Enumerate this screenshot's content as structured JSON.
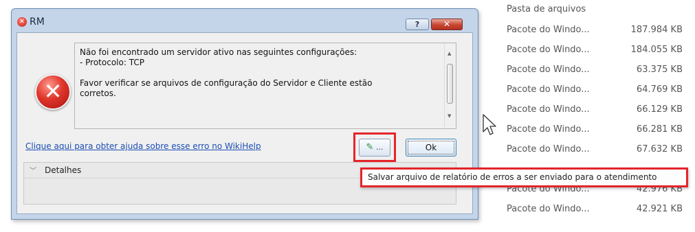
{
  "dialog": {
    "title": "RM",
    "title_icon": "error-icon",
    "help_label": "?",
    "close_label": "✕",
    "message_lines": [
      "Não foi encontrado um servidor ativo nas seguintes configurações:",
      "- Protocolo: TCP",
      "",
      "Favor verificar se arquivos de configuração do Servidor e Cliente estão",
      "corretos."
    ],
    "help_link": "Clique aqui para obter ajuda sobre esse erro no WikiHelp",
    "report_button_label": "...",
    "ok_label": "Ok",
    "details_label": "Detalhes"
  },
  "tooltip": {
    "text": "Salvar arquivo de relatório de erros a ser enviado para o atendimento"
  },
  "file_list": {
    "header": "Pasta de arquivos",
    "rows": [
      {
        "name": "Pacote do Windo...",
        "size": "187.984 KB"
      },
      {
        "name": "Pacote do Windo...",
        "size": "184.055 KB"
      },
      {
        "name": "Pacote do Windo...",
        "size": "63.375 KB"
      },
      {
        "name": "Pacote do Windo...",
        "size": "64.769 KB"
      },
      {
        "name": "Pacote do Windo...",
        "size": "66.129 KB"
      },
      {
        "name": "Pacote do Windo...",
        "size": "66.281 KB"
      },
      {
        "name": "Pacote do Windo...",
        "size": "67.632 KB"
      },
      {
        "name": "Pacote do Windo...",
        "size": "42.976 KB"
      },
      {
        "name": "Pacote do Windo...",
        "size": "42.921 KB"
      }
    ]
  },
  "colors": {
    "highlight": "#e5242a",
    "link": "#1b4db3",
    "title_bar": "#c4d5ea"
  }
}
